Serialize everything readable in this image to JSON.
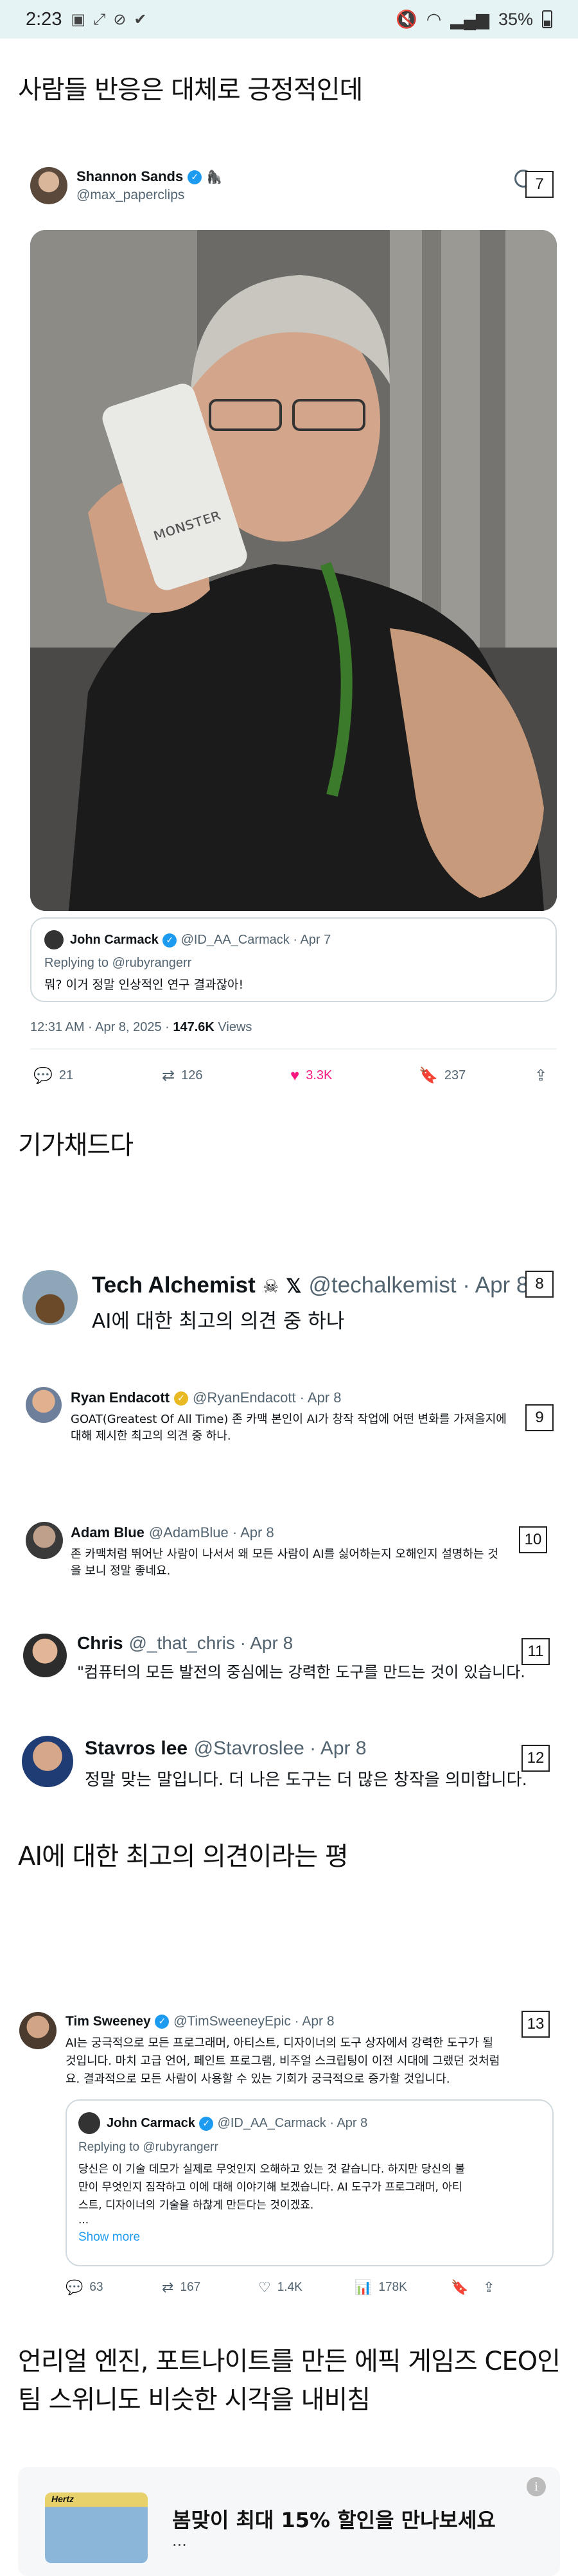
{
  "status_bar": {
    "time": "2:23",
    "battery": "35%"
  },
  "post": {
    "text1": "사람들 반응은 대체로 긍정적인데",
    "text2": "기가채드다",
    "text3": "AI에 대한 최고의 의견이라는 평",
    "text4a": "언리얼 엔진, 포트나이트를 만든 에픽 게임즈 CEO인",
    "text4b": "팀 스위니도 비슷한 시각을 내비침"
  },
  "tweet1": {
    "name": "Shannon Sands",
    "handle": "@max_paperclips",
    "badge": "7",
    "quote": {
      "name": "John Carmack",
      "handle": "@ID_AA_Carmack · Apr 7",
      "reply": "Replying to @rubyrangerr",
      "text": "뭐? 이거 정말 인상적인 연구 결과잖아!"
    },
    "meta_time": "12:31 AM · Apr 8, 2025 · ",
    "meta_views": "147.6K",
    "meta_views_label": " Views",
    "replies": "21",
    "retweets": "126",
    "likes": "3.3K",
    "bookmarks": "237"
  },
  "tweet2": {
    "name": "Tech Alchemist",
    "handle": "@techalkemist · Apr 8",
    "badge": "8",
    "text": "AI에 대한 최고의 의견 중 하나"
  },
  "tweet3": {
    "name": "Ryan Endacott",
    "handle": "@RyanEndacott · Apr 8",
    "badge": "9",
    "text1": "GOAT(Greatest Of All Time) 존 카맥 본인이 AI가 창작 작업에 어떤 변화를 가져올지에",
    "text2": "대해 제시한 최고의 의견 중 하나."
  },
  "tweet4": {
    "name": "Adam Blue",
    "handle": "@AdamBlue · Apr 8",
    "badge": "10",
    "text1": "존 카맥처럼 뛰어난 사람이 나서서 왜 모든 사람이 AI를 싫어하는지 오해인지 설명하는 것",
    "text2": "을 보니 정말 좋네요."
  },
  "tweet5": {
    "name": "Chris",
    "handle": "@_that_chris · Apr 8",
    "badge": "11",
    "text": "\"컴퓨터의 모든 발전의 중심에는 강력한 도구를 만드는 것이 있습니다."
  },
  "tweet6": {
    "name": "Stavros lee",
    "handle": "@Stavroslee · Apr 8",
    "badge": "12",
    "text": "정말 맞는 말입니다. 더 나은 도구는 더 많은 창작을 의미합니다."
  },
  "tweet7": {
    "name": "Tim Sweeney",
    "handle": "@TimSweeneyEpic · Apr 8",
    "badge": "13",
    "text1": "AI는 궁극적으로 모든 프로그래머, 아티스트, 디자이너의 도구 상자에서 강력한 도구가 될",
    "text2": "것입니다. 마치 고급 언어, 페인트 프로그램, 비주얼 스크립팅이 이전 시대에 그랬던 것처럼",
    "text3": "요. 결과적으로 모든 사람이 사용할 수 있는 기회가 궁극적으로 증가할 것입니다.",
    "quote": {
      "name": "John Carmack",
      "handle": "@ID_AA_Carmack · Apr 8",
      "reply": "Replying to @rubyrangerr",
      "text1": "당신은 이 기술 데모가 실제로 무엇인지 오해하고 있는 것 같습니다. 하지만 당신의 불",
      "text2": "만이 무엇인지 짐작하고 이에 대해 이야기해 보겠습니다. AI 도구가 프로그래머, 아티",
      "text3": "스트, 디자이너의 기술을 하찮게 만든다는 것이겠죠.",
      "ellipsis": "...",
      "show_more": "Show more"
    },
    "replies": "63",
    "retweets": "167",
    "likes": "1.4K",
    "views": "178K"
  },
  "ad": {
    "brand": "Hertz",
    "title": "봄맞이 최대 15% 할인을 만나보세요",
    "sub": "···"
  },
  "colors": {
    "verified": "#1d9bf0",
    "like": "#f91880",
    "statusbar_bg": "#e5f3f5"
  }
}
